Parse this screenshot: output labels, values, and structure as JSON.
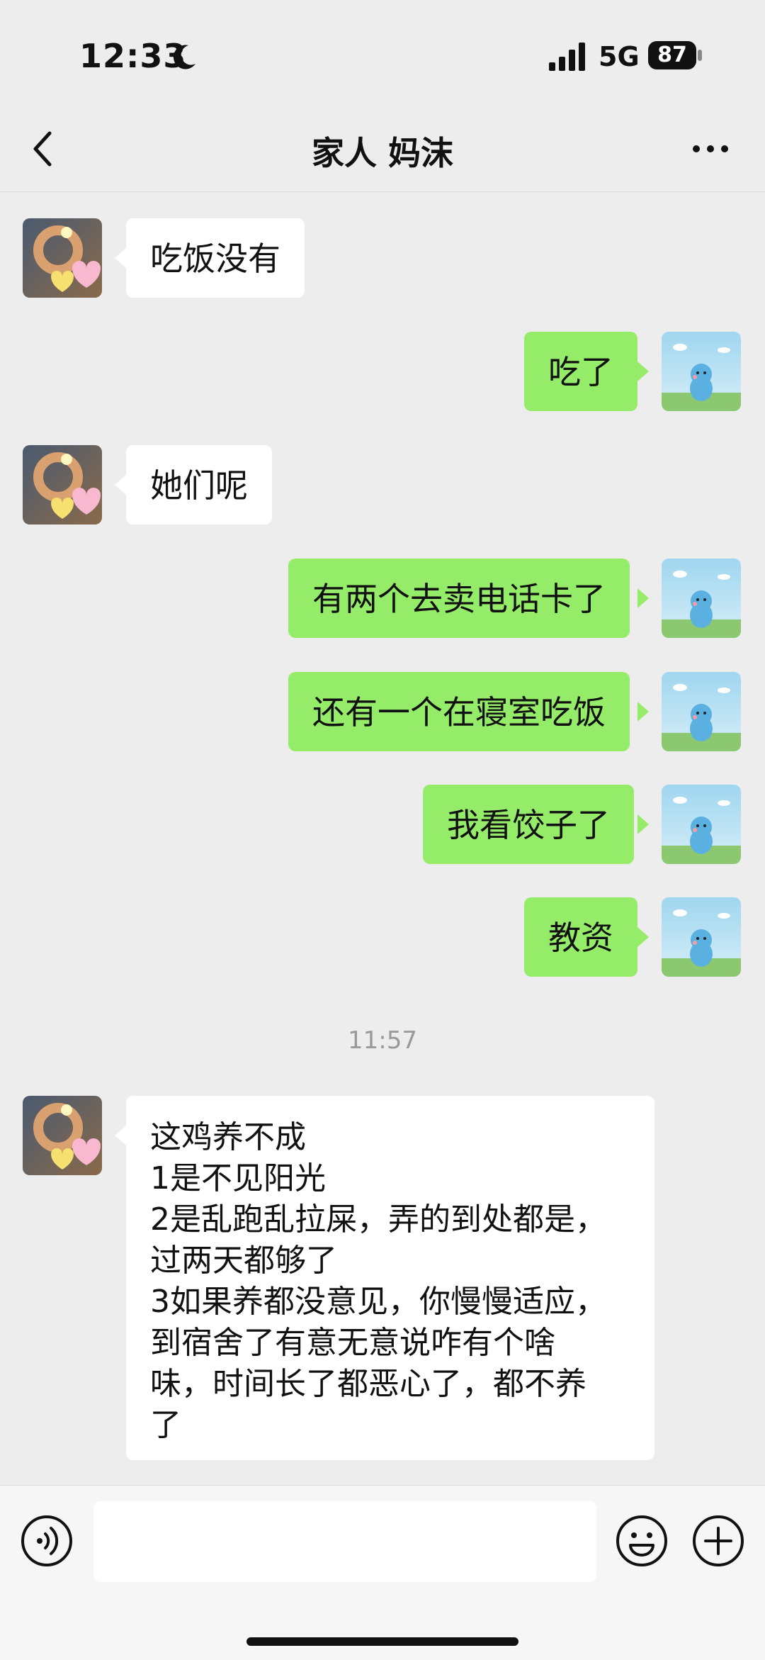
{
  "status": {
    "time": "12:33",
    "network": "5G",
    "battery": "87"
  },
  "header": {
    "title": "家人 妈沫"
  },
  "messages": [
    {
      "side": "left",
      "text": "吃饭没有"
    },
    {
      "side": "right",
      "text": "吃了"
    },
    {
      "side": "left",
      "text": "她们呢"
    },
    {
      "side": "right",
      "text": "有两个去卖电话卡了"
    },
    {
      "side": "right",
      "text": "还有一个在寝室吃饭"
    },
    {
      "side": "right",
      "text": "我看饺子了"
    },
    {
      "side": "right",
      "text": "教资"
    },
    {
      "side": "left",
      "text": "这鸡养不成\n1是不见阳光\n2是乱跑乱拉屎，弄的到处都是，\n过两天都够了\n3如果养都没意见，你慢慢适应，\n到宿舍了有意无意说咋有个啥\n味，时间长了都恶心了，都不养\n了"
    }
  ],
  "timestamp": "11:57",
  "colors": {
    "sent_bubble": "#95ec69",
    "received_bubble": "#ffffff",
    "background": "#ededed"
  },
  "icons": {
    "back": "chevron-left-icon",
    "more": "more-horizontal-icon",
    "voice": "voice-icon",
    "emoji": "emoji-icon",
    "plus": "plus-icon"
  }
}
